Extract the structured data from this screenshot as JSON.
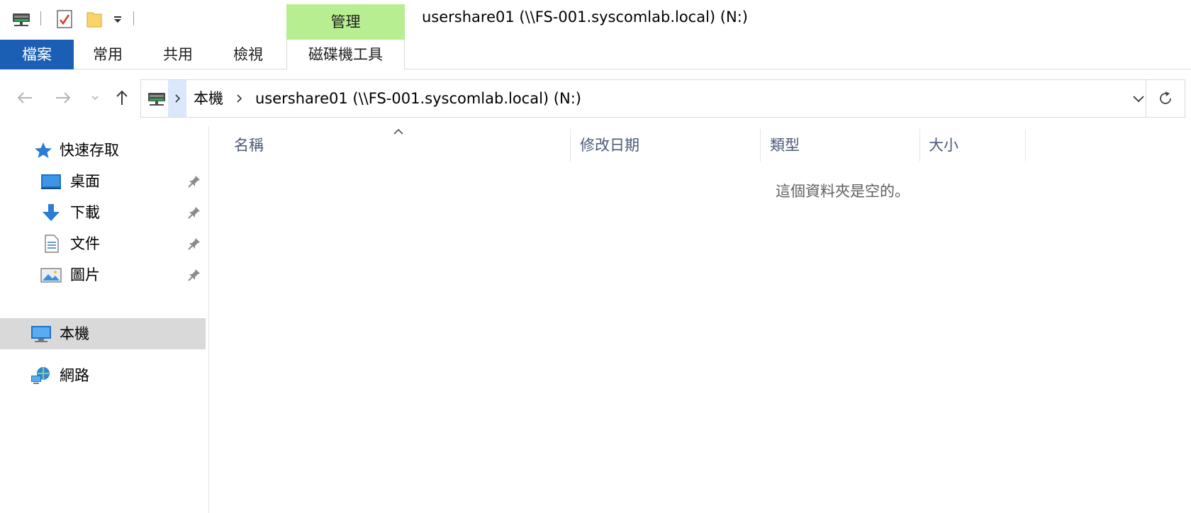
{
  "window": {
    "title": "usershare01 (\\\\FS-001.syscomlab.local) (N:)"
  },
  "ribbon": {
    "context_group": "管理",
    "tabs": [
      {
        "label": "檔案"
      },
      {
        "label": "常用"
      },
      {
        "label": "共用"
      },
      {
        "label": "檢視"
      },
      {
        "label": "磁碟機工具"
      }
    ]
  },
  "address": {
    "crumbs": [
      "本機",
      "usershare01 (\\\\FS-001.syscomlab.local) (N:)"
    ]
  },
  "nav": {
    "quick_access": "快速存取",
    "pinned": [
      {
        "label": "桌面",
        "icon": "desktop-icon"
      },
      {
        "label": "下載",
        "icon": "download-icon"
      },
      {
        "label": "文件",
        "icon": "document-icon"
      },
      {
        "label": "圖片",
        "icon": "picture-icon"
      }
    ],
    "this_pc": "本機",
    "network": "網路"
  },
  "content": {
    "columns": [
      "名稱",
      "修改日期",
      "類型",
      "大小"
    ],
    "empty_message": "這個資料夾是空的。"
  },
  "colors": {
    "file_tab": "#1a5fb4",
    "context_tab": "#b7ee91",
    "selected_nav": "#d9d9d9",
    "address_highlight": "#d9e8fb"
  }
}
